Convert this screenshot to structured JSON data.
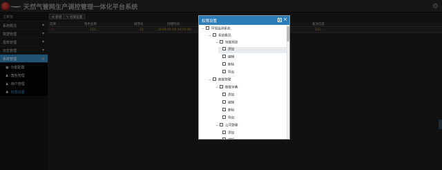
{
  "app": {
    "title": "天然气管网生产调控管理一体化平台系统"
  },
  "sidebar": {
    "header": "主菜单",
    "items": [
      {
        "label": "系统概况",
        "chevron": "▾"
      },
      {
        "label": "数据管理",
        "chevron": "▾"
      },
      {
        "label": "报表管理",
        "chevron": "▾"
      },
      {
        "label": "日志管理",
        "chevron": "▾"
      },
      {
        "label": "系统管理",
        "chevron": "▴"
      }
    ],
    "subitems": [
      {
        "label": "功能配置",
        "icon": "▣"
      },
      {
        "label": "角色管理",
        "icon": "♟"
      },
      {
        "label": "用户管理",
        "icon": "♟"
      },
      {
        "label": "权限设置",
        "icon": "♣"
      }
    ]
  },
  "toolbar": {
    "add_label": "新增",
    "permission_label": "权限设置"
  },
  "table": {
    "columns": [
      "选择",
      "角色名称",
      "排序号",
      "创建时间",
      "备注信息"
    ],
    "rows": [
      {
        "select": "✎",
        "name": "123",
        "order": "12",
        "created": "2018-06-28 14:03:49",
        "remark": "123"
      }
    ]
  },
  "modal": {
    "title": "权限设置",
    "save_icon": "save-icon",
    "close_label": "×",
    "tree": [
      {
        "toggle": "−",
        "label": "环境监测系统"
      },
      {
        "toggle": "−",
        "label": "系统概况"
      },
      {
        "toggle": "−",
        "label": "地图预览"
      },
      {
        "toggle": "",
        "label": "添加"
      },
      {
        "toggle": "",
        "label": "编辑"
      },
      {
        "toggle": "",
        "label": "删除"
      },
      {
        "toggle": "",
        "label": "导出"
      },
      {
        "toggle": "−",
        "label": "数据管理"
      },
      {
        "toggle": "−",
        "label": "数据字典"
      },
      {
        "toggle": "",
        "label": "添加"
      },
      {
        "toggle": "",
        "label": "编辑"
      },
      {
        "toggle": "",
        "label": "删除"
      },
      {
        "toggle": "",
        "label": "导出"
      },
      {
        "toggle": "−",
        "label": "公司管理"
      },
      {
        "toggle": "",
        "label": "添加"
      },
      {
        "toggle": "",
        "label": "编辑"
      }
    ]
  }
}
